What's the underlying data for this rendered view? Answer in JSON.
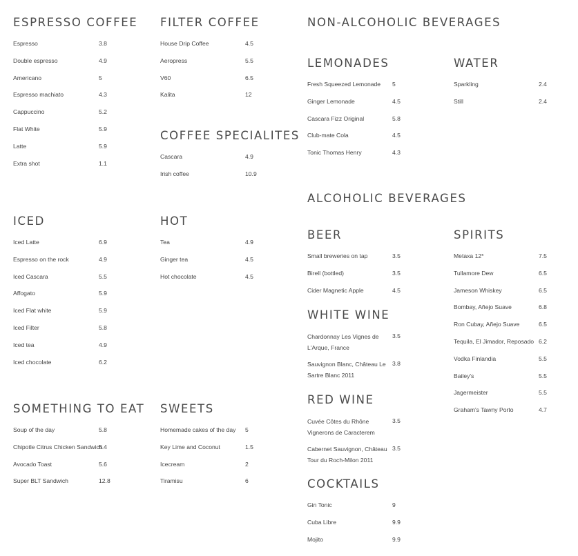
{
  "espresso": {
    "title": "ESPRESSO COFFEE",
    "items": [
      {
        "name": "Espresso",
        "price": "3.8"
      },
      {
        "name": "Double espresso",
        "price": "4.9"
      },
      {
        "name": "Americano",
        "price": "5"
      },
      {
        "name": "Espresso machiato",
        "price": "4.3"
      },
      {
        "name": "Cappuccino",
        "price": "5.2"
      },
      {
        "name": "Flat White",
        "price": "5.9"
      },
      {
        "name": "Latte",
        "price": "5.9"
      },
      {
        "name": "Extra shot",
        "price": "1.1"
      }
    ]
  },
  "filter": {
    "title": "FILTER COFFEE",
    "items": [
      {
        "name": "House Drip Coffee",
        "price": "4.5"
      },
      {
        "name": "Aeropress",
        "price": "5.5"
      },
      {
        "name": "V60",
        "price": "6.5"
      },
      {
        "name": "Kalita",
        "price": "12"
      }
    ]
  },
  "specialites": {
    "title": "COFFEE SPECIALITES",
    "items": [
      {
        "name": "Cascara",
        "price": "4.9"
      },
      {
        "name": "Irish coffee",
        "price": "10.9"
      }
    ]
  },
  "non_alcoholic": {
    "title": "NON-ALCOHOLIC BEVERAGES"
  },
  "lemonades": {
    "title": "LEMONADES",
    "items": [
      {
        "name": "Fresh Squeezed Lemonade",
        "price": "5"
      },
      {
        "name": "Ginger Lemonade",
        "price": "4.5"
      },
      {
        "name": "Cascara Fizz Original",
        "price": "5.8"
      },
      {
        "name": "Club-mate Cola",
        "price": "4.5"
      },
      {
        "name": "Tonic Thomas Henry",
        "price": "4.3"
      }
    ]
  },
  "water": {
    "title": "WATER",
    "items": [
      {
        "name": "Sparkling",
        "price": "2.4"
      },
      {
        "name": "Still",
        "price": "2.4"
      }
    ]
  },
  "iced": {
    "title": "ICED",
    "items": [
      {
        "name": "Iced Latte",
        "price": "6.9"
      },
      {
        "name": "Espresso on the rock",
        "price": "4.9"
      },
      {
        "name": "Iced Cascara",
        "price": "5.5"
      },
      {
        "name": "Affogato",
        "price": "5.9"
      },
      {
        "name": "Iced Flat white",
        "price": "5.9"
      },
      {
        "name": "Iced Filter",
        "price": "5.8"
      },
      {
        "name": "Iced tea",
        "price": "4.9"
      },
      {
        "name": "Iced chocolate",
        "price": "6.2"
      }
    ]
  },
  "hot": {
    "title": "HOT",
    "items": [
      {
        "name": "Tea",
        "price": "4.9"
      },
      {
        "name": "Ginger tea",
        "price": "4.5"
      },
      {
        "name": "Hot chocolate",
        "price": "4.5"
      }
    ]
  },
  "alcoholic": {
    "title": "ALCOHOLIC BEVERAGES"
  },
  "beer": {
    "title": "BEER",
    "items": [
      {
        "name": "Small breweries on tap",
        "price": "3.5"
      },
      {
        "name": "Birell (bottled)",
        "price": "3.5"
      },
      {
        "name": "Cider Magnetic Apple",
        "price": "4.5"
      }
    ]
  },
  "white_wine": {
    "title": "WHITE WINE",
    "items": [
      {
        "name": "Chardonnay Les Vignes de L'Arque, France",
        "price": "3.5"
      },
      {
        "name": "Sauvignon Blanc, Château Le Sartre Blanc 2011",
        "price": "3.8"
      }
    ]
  },
  "red_wine": {
    "title": "RED WINE",
    "items": [
      {
        "name": "Cuvée Côtes du Rhône Vignerons de Caracterem",
        "price": "3.5"
      },
      {
        "name": "Cabernet Sauvignon, Château Tour du Roch-Milon 2011",
        "price": "3.5"
      }
    ]
  },
  "cocktails": {
    "title": "COCKTAILS",
    "items": [
      {
        "name": "Gin Tonic",
        "price": "9"
      },
      {
        "name": "Cuba Libre",
        "price": "9.9"
      },
      {
        "name": "Mojito",
        "price": "9.9"
      }
    ]
  },
  "spirits": {
    "title": "SPIRITS",
    "items": [
      {
        "name": "Metaxa 12*",
        "price": "7.5"
      },
      {
        "name": "Tullamore Dew",
        "price": "6.5"
      },
      {
        "name": "Jameson Whiskey",
        "price": "6.5"
      },
      {
        "name": "Bombay, Añejo Suave",
        "price": "6.8"
      },
      {
        "name": "Ron Cubay, Añejo Suave",
        "price": "6.5"
      },
      {
        "name": "Tequila, El Jimador, Reposado",
        "price": "6.2"
      },
      {
        "name": "Vodka Finlandia",
        "price": "5.5"
      },
      {
        "name": "Bailey's",
        "price": "5.5"
      },
      {
        "name": "Jagermeister",
        "price": "5.5"
      },
      {
        "name": "Graham's Tawny Porto",
        "price": "4.7"
      }
    ]
  },
  "eat": {
    "title": "SOMETHING TO EAT",
    "items": [
      {
        "name": "Soup of the day",
        "price": "5.8"
      },
      {
        "name": "Chipotle Citrus Chicken Sandwich",
        "price": "5.4"
      },
      {
        "name": "Avocado Toast",
        "price": "5.6"
      },
      {
        "name": "Super BLT Sandwich",
        "price": "12.8"
      }
    ]
  },
  "sweets": {
    "title": "SWEETS",
    "items": [
      {
        "name": "Homemade cakes of the day",
        "price": "5"
      },
      {
        "name": "Key Lime and Coconut",
        "price": "1.5"
      },
      {
        "name": "Icecream",
        "price": "2"
      },
      {
        "name": "Tiramisu",
        "price": "6"
      }
    ]
  }
}
